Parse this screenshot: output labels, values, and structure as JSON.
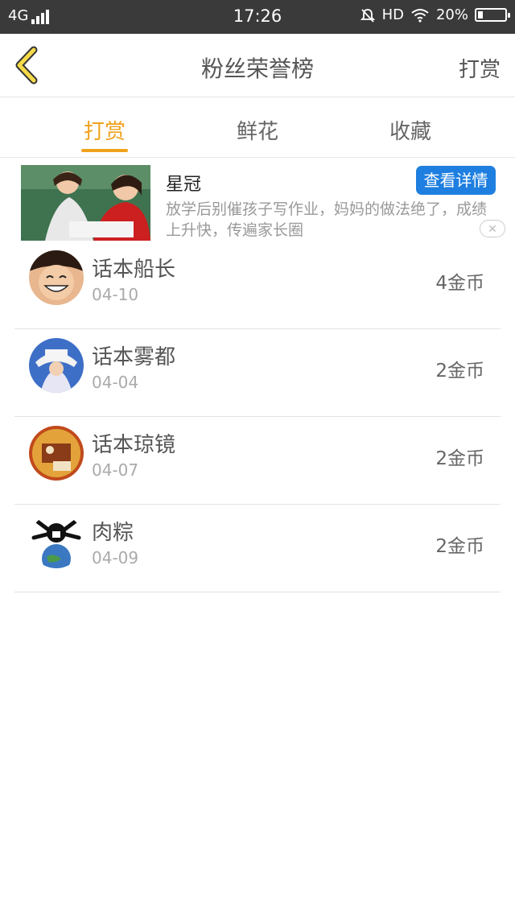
{
  "status_bar": {
    "network": "4G",
    "time": "17:26",
    "hd": "HD",
    "battery": "20%",
    "battery_level": 0.2
  },
  "header": {
    "title": "粉丝荣誉榜",
    "action": "打赏"
  },
  "tabs": [
    {
      "label": "打赏",
      "active": true
    },
    {
      "label": "鲜花",
      "active": false
    },
    {
      "label": "收藏",
      "active": false
    }
  ],
  "ad": {
    "title": "星冠",
    "button": "查看详情",
    "description": "放学后别催孩子写作业，妈妈的做法绝了，成绩上升快，传遍家长圈"
  },
  "fans": [
    {
      "name": "话本船长",
      "date": "04-10",
      "amount": "4金币"
    },
    {
      "name": "话本雾都",
      "date": "04-04",
      "amount": "2金币"
    },
    {
      "name": "话本琼镜",
      "date": "04-07",
      "amount": "2金币"
    },
    {
      "name": "肉粽",
      "date": "04-09",
      "amount": "2金币"
    }
  ],
  "colors": {
    "accent": "#f0a21d",
    "ad_button": "#1f7fe0",
    "status_bar": "#3a3a3a"
  }
}
